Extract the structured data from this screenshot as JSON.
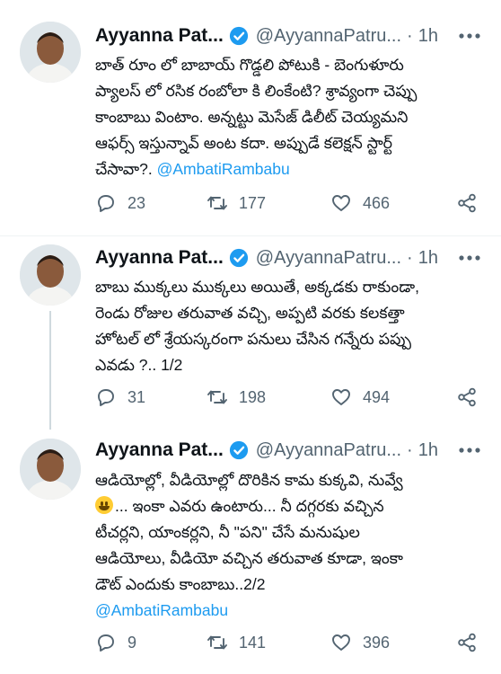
{
  "tweets": [
    {
      "name": "Ayyanna Pat...",
      "handle": "@AyyannaPatru...",
      "sep": "·",
      "time": "1h",
      "lines": [
        "బాత్ రూం లో బాబాయ్ గొడ్డలి పోటుకి - బెంగుళూరు",
        "ప్యాలస్ లో రసిక రంబోలా కి లింకేంటి? శ్రావ్యంగా చెప్పు",
        "కాంబాబు వింటాం.  అన్నట్టు మెసేజ్ డిలీట్ చెయ్యమని",
        "ఆఫర్స్ ఇస్తున్నావ్ అంట కదా. అప్పుడే కలెక్షన్ స్టార్ట్",
        "చేసావా?. "
      ],
      "mention": "@AmbatiRambabu",
      "replies": "23",
      "retweets": "177",
      "likes": "466"
    },
    {
      "name": "Ayyanna Pat...",
      "handle": "@AyyannaPatru...",
      "sep": "·",
      "time": "1h",
      "lines": [
        "బాబు ముక్కలు ముక్కలు అయితే, అక్కడకు రాకుండా,",
        "రెండు రోజుల తరువాత వచ్చి, అప్పటి వరకు కలకత్తా",
        "హోటల్ లో శ్రేయస్కరంగా పనులు చేసిన గన్నేరు పప్పు",
        "ఎవడు ?.. 1/2"
      ],
      "replies": "31",
      "retweets": "198",
      "likes": "494"
    },
    {
      "name": "Ayyanna Pat...",
      "handle": "@AyyannaPatru...",
      "sep": "·",
      "time": "1h",
      "lines": [
        "ఆడియోల్లో,  వీడియోల్లో దొరికిన కామ కుక్కవి, నువ్వే",
        "... ఇంకా ఎవరు ఉంటారు... నీ దగ్గరకు వచ్చిన",
        "టీచర్లని, యాంకర్లని, నీ \"పని\" చేసే మనుషుల",
        "ఆడియోలు, వీడియో వచ్చిన తరువాత కూడా, ఇంకా",
        "డౌట్ ఎందుకు కాంబాబు..2/2"
      ],
      "mention": "@AmbatiRambabu",
      "emoji": "grinning-face",
      "replies": "9",
      "retweets": "141",
      "likes": "396"
    }
  ],
  "colors": {
    "text": "#0f1419",
    "secondary": "#536471",
    "link": "#1d9bf0",
    "verified": "#1d9bf0",
    "divider": "#eff3f4",
    "thread_line": "#cfd9de"
  }
}
